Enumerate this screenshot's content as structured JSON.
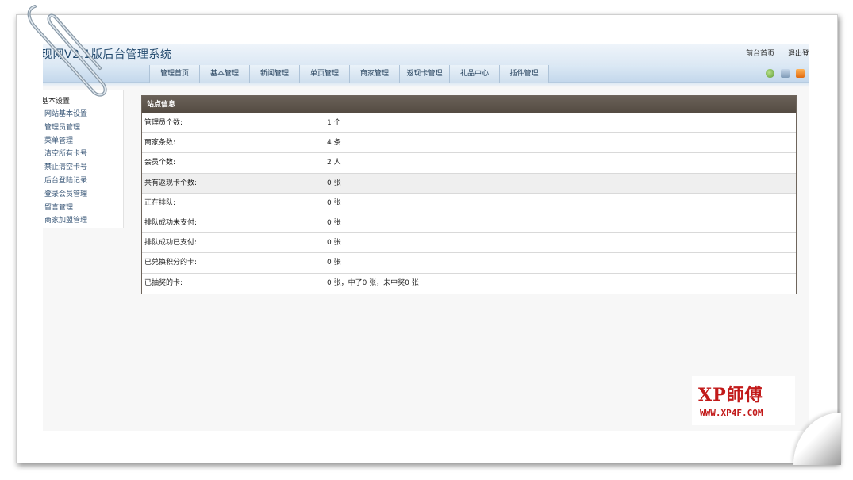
{
  "header": {
    "title": "现网V2.1版后台管理系统",
    "links": [
      "前台首页",
      "退出登"
    ]
  },
  "nav": {
    "tabs": [
      "管理首页",
      "基本管理",
      "新闻管理",
      "单页管理",
      "商家管理",
      "返现卡管理",
      "礼品中心",
      "插件管理"
    ],
    "icons": [
      "refresh-icon",
      "copy-icon",
      "rss-icon"
    ]
  },
  "sidebar": {
    "heading": "基本设置",
    "items": [
      "网站基本设置",
      "管理员管理",
      "菜单管理",
      "清空所有卡号",
      "禁止清空卡号",
      "后台登陆记录",
      "登录会员管理",
      "留言管理",
      "商家加盟管理"
    ]
  },
  "site_info": {
    "heading": "站点信息",
    "rows": [
      {
        "label": "管理员个数:",
        "value": "1 个"
      },
      {
        "label": "商家条数:",
        "value": "4 条"
      },
      {
        "label": "会员个数:",
        "value": "2 人"
      },
      {
        "label": "共有返现卡个数:",
        "value": "0 张"
      },
      {
        "label": "正在排队:",
        "value": "0 张"
      },
      {
        "label": "排队成功未支付:",
        "value": "0 张"
      },
      {
        "label": "排队成功已支付:",
        "value": "0 张"
      },
      {
        "label": "已兑换积分的卡:",
        "value": "0 张"
      },
      {
        "label": "已抽奖的卡:",
        "value": "0 张，中了0 张，未中奖0 张"
      }
    ]
  },
  "watermark": {
    "title": "XP師傅",
    "url": "WWW.XP4F.COM"
  },
  "colors": {
    "table_header": "#5e554c",
    "nav_bg": "#cfdfee",
    "watermark": "#c21a1a"
  }
}
